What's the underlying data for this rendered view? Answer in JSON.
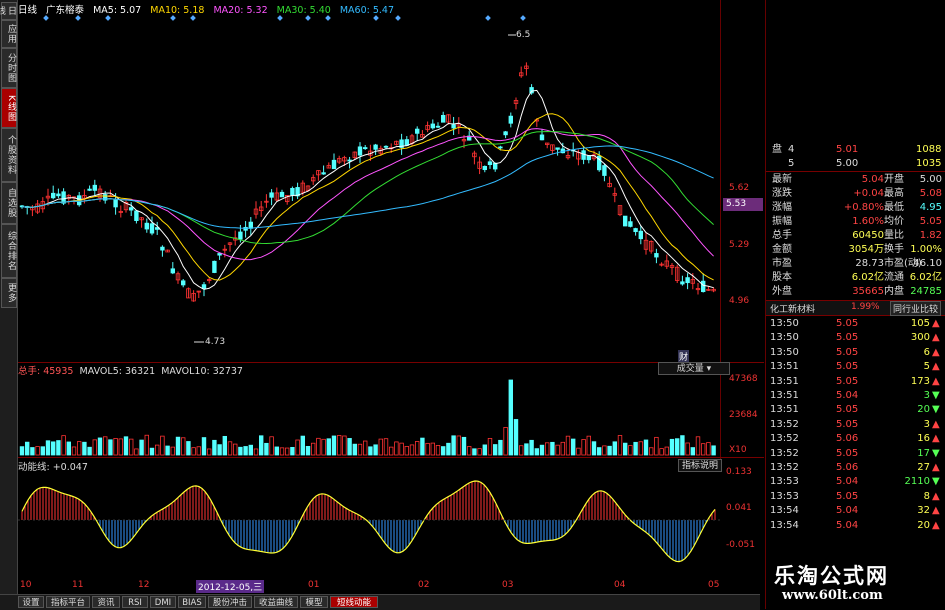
{
  "left_tabs": [
    "日线",
    "应用",
    "分时图",
    "K线图",
    "个股资料",
    "自选股",
    "综合排名",
    "更多"
  ],
  "header": {
    "period": "日线",
    "stock": "广东榕泰",
    "ma": [
      {
        "label": "MA5: 5.07",
        "color": "#ffffff"
      },
      {
        "label": "MA10: 5.18",
        "color": "#ffd700"
      },
      {
        "label": "MA20: 5.32",
        "color": "#ff55ff"
      },
      {
        "label": "MA30: 5.40",
        "color": "#33dd33"
      },
      {
        "label": "MA60: 5.47",
        "color": "#33bbff"
      }
    ]
  },
  "price_axis": {
    "labels": [
      "5.62",
      "5.29",
      "4.96"
    ],
    "current_price": "5.53"
  },
  "annotations": {
    "high": "6.5",
    "low": "4.73",
    "cai": "财"
  },
  "volume": {
    "title": "总手: 45935",
    "mavol5": "MAVOL5: 36321",
    "mavol10": "MAVOL10: 32737",
    "axis": [
      "47368",
      "23684",
      "X10"
    ],
    "selector": "成交量"
  },
  "dongneng": {
    "title": "动能线: +0.047",
    "axis": [
      "0.133",
      "0.041",
      "-0.051"
    ],
    "button": "指标说明"
  },
  "time_axis": {
    "ticks": [
      "10",
      "11",
      "12",
      "2012-12-05,三",
      "01",
      "02",
      "03",
      "04",
      "05"
    ]
  },
  "bottom_tabs": [
    "设置",
    "指标平台",
    "资讯",
    "RSI",
    "DMI",
    "BIAS",
    "股份冲击",
    "收益曲线",
    "模型",
    "短线动能"
  ],
  "order_book": [
    {
      "label": "盘",
      "level": "4",
      "price": "5.01",
      "vol": "1088"
    },
    {
      "label": "",
      "level": "5",
      "price": "5.00",
      "vol": "1035"
    }
  ],
  "quote_stats": [
    {
      "k1": "最新",
      "v1": "5.04",
      "k2": "开盘",
      "v2": "5.00"
    },
    {
      "k1": "涨跌",
      "v1": "+0.04",
      "k2": "最高",
      "v2": "5.08"
    },
    {
      "k1": "涨幅",
      "v1": "+0.80%",
      "k2": "最低",
      "v2": "4.95"
    },
    {
      "k1": "振幅",
      "v1": "1.60%",
      "k2": "均价",
      "v2": "5.05"
    },
    {
      "k1": "总手",
      "v1": "60450",
      "k2": "量比",
      "v2": "1.82"
    },
    {
      "k1": "金额",
      "v1": "3054万",
      "k2": "换手",
      "v2": "1.00%"
    },
    {
      "k1": "市盈",
      "v1": "28.73",
      "k2": "市盈(动)",
      "v2": "46.10"
    },
    {
      "k1": "股本",
      "v1": "6.02亿",
      "k2": "流通",
      "v2": "6.02亿"
    },
    {
      "k1": "外盘",
      "v1": "35665",
      "k2": "内盘",
      "v2": "24785"
    }
  ],
  "industry": {
    "name": "化工新材料",
    "pct": "1.99%",
    "compare": "同行业比较"
  },
  "ticks": [
    {
      "t": "13:50",
      "p": "5.05",
      "v": "105",
      "d": "up"
    },
    {
      "t": "13:50",
      "p": "5.05",
      "v": "300",
      "d": "up"
    },
    {
      "t": "13:50",
      "p": "5.05",
      "v": "6",
      "d": "up"
    },
    {
      "t": "13:51",
      "p": "5.05",
      "v": "5",
      "d": "up"
    },
    {
      "t": "13:51",
      "p": "5.05",
      "v": "173",
      "d": "up"
    },
    {
      "t": "13:51",
      "p": "5.04",
      "v": "3",
      "d": "down"
    },
    {
      "t": "13:51",
      "p": "5.05",
      "v": "20",
      "d": "down"
    },
    {
      "t": "13:52",
      "p": "5.05",
      "v": "3",
      "d": "up"
    },
    {
      "t": "13:52",
      "p": "5.06",
      "v": "16",
      "d": "up"
    },
    {
      "t": "13:52",
      "p": "5.05",
      "v": "17",
      "d": "down"
    },
    {
      "t": "13:52",
      "p": "5.06",
      "v": "27",
      "d": "up"
    },
    {
      "t": "13:53",
      "p": "5.04",
      "v": "2110",
      "d": "down"
    },
    {
      "t": "13:53",
      "p": "5.05",
      "v": "8",
      "d": "up"
    },
    {
      "t": "13:54",
      "p": "5.04",
      "v": "32",
      "d": "up"
    },
    {
      "t": "13:54",
      "p": "5.04",
      "v": "20",
      "d": "up"
    }
  ],
  "watermark": {
    "title": "乐淘公式网",
    "url": "www.60lt.com"
  },
  "colors": {
    "up": "#ff4444",
    "down": "#55ffff",
    "neutral": "#ffff55",
    "panel_bg": "#000000"
  }
}
